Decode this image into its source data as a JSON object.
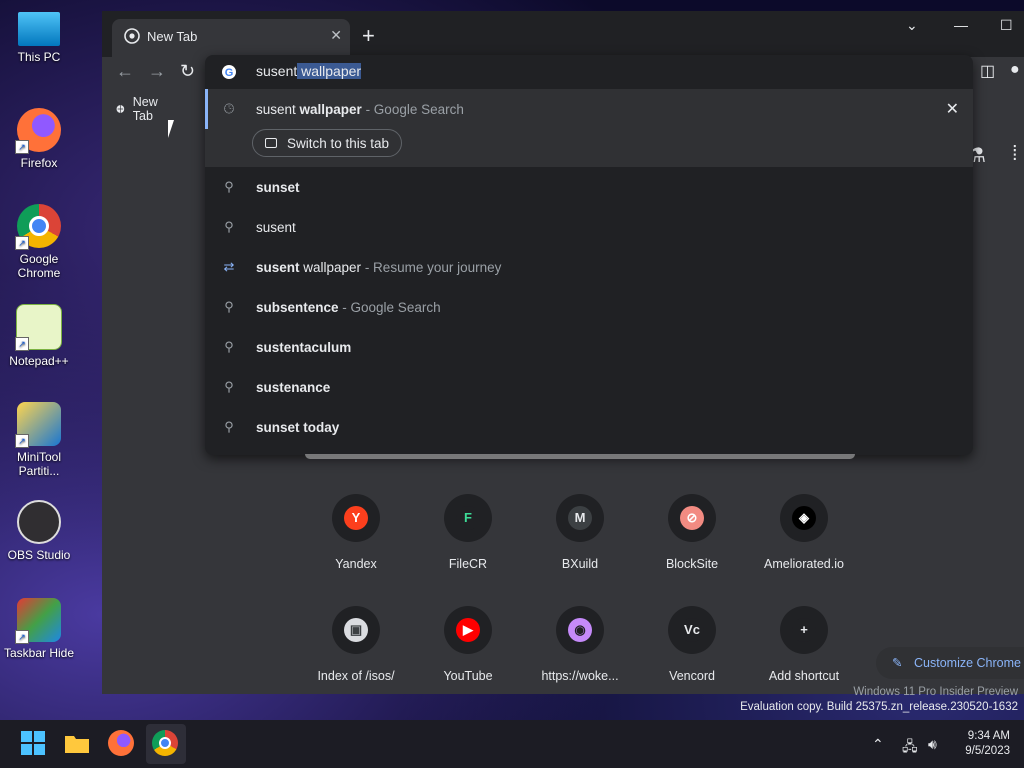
{
  "desktop": {
    "icons": [
      {
        "label": "This PC",
        "icon": "monitor-icon"
      },
      {
        "label": "Firefox",
        "icon": "firefox-icon"
      },
      {
        "label": "Google Chrome",
        "icon": "chrome-icon"
      },
      {
        "label": "Notepad++",
        "icon": "notepadpp-icon"
      },
      {
        "label": "MiniTool Partiti...",
        "icon": "minitool-icon"
      },
      {
        "label": "OBS Studio",
        "icon": "obs-icon"
      },
      {
        "label": "Taskbar Hide",
        "icon": "taskbar-hide-icon"
      }
    ]
  },
  "browser": {
    "tab_title": "New Tab",
    "new_tab_symbol": "+",
    "bookmark_label": "New Tab",
    "omnibox": {
      "typed": "susent",
      "autocomplete": " wallpaper",
      "first_suggestion": {
        "bold_prefix": "susent ",
        "bold": "wallpaper",
        "suffix": " - Google Search",
        "switch_label": "Switch to this tab"
      },
      "suggestions": [
        {
          "icon": "search-icon",
          "bold": "sunset",
          "normal": "",
          "sub": ""
        },
        {
          "icon": "search-icon",
          "bold": "",
          "normal": "susent",
          "sub": ""
        },
        {
          "icon": "journey-icon",
          "bold": "susent",
          "normal": " wallpaper",
          "sub": " - Resume your journey"
        },
        {
          "icon": "search-icon",
          "bold": "subsentence",
          "normal": "",
          "sub": " - Google Search"
        },
        {
          "icon": "search-icon",
          "bold": "sustentaculum",
          "normal": "",
          "sub": ""
        },
        {
          "icon": "search-icon",
          "bold": "sustenance",
          "normal": "",
          "sub": ""
        },
        {
          "icon": "search-icon",
          "bold": "sunset today",
          "normal": "",
          "sub": ""
        }
      ]
    },
    "shortcuts": [
      {
        "name": "Yandex",
        "glyph": "Y",
        "bg": "#fc3f1d",
        "fg": "#ffffff"
      },
      {
        "name": "FileCR",
        "glyph": "F",
        "bg": "#202124",
        "fg": "#3ddc97"
      },
      {
        "name": "BXuild",
        "glyph": "M",
        "bg": "#3c4043",
        "fg": "#e8eaed"
      },
      {
        "name": "BlockSite",
        "glyph": "⊘",
        "bg": "#f28b82",
        "fg": "#ffffff"
      },
      {
        "name": "Ameliorated.io",
        "glyph": "◈",
        "bg": "#000000",
        "fg": "#ffffff"
      },
      {
        "name": "Index of /isos/",
        "glyph": "▣",
        "bg": "#dadce0",
        "fg": "#3c4043"
      },
      {
        "name": "YouTube",
        "glyph": "▶",
        "bg": "#ff0000",
        "fg": "#ffffff"
      },
      {
        "name": "https://woke...",
        "glyph": "◉",
        "bg": "#c58af9",
        "fg": "#202124"
      },
      {
        "name": "Vencord",
        "glyph": "Vc",
        "bg": "#202124",
        "fg": "#e8eaed"
      },
      {
        "name": "Add shortcut",
        "glyph": "+",
        "bg": "#202124",
        "fg": "#e8eaed"
      }
    ],
    "customize_label": "Customize Chrome"
  },
  "watermark": {
    "line1": "Windows 11 Pro Insider Preview",
    "line2": "Evaluation copy. Build 25375.zn_release.230520-1632"
  },
  "taskbar": {
    "time": "9:34 AM",
    "date": "9/5/2023"
  },
  "colors": {
    "accent": "#8ab4f8",
    "omnibox_bg": "#202124",
    "selected_row_bg": "#303134"
  }
}
